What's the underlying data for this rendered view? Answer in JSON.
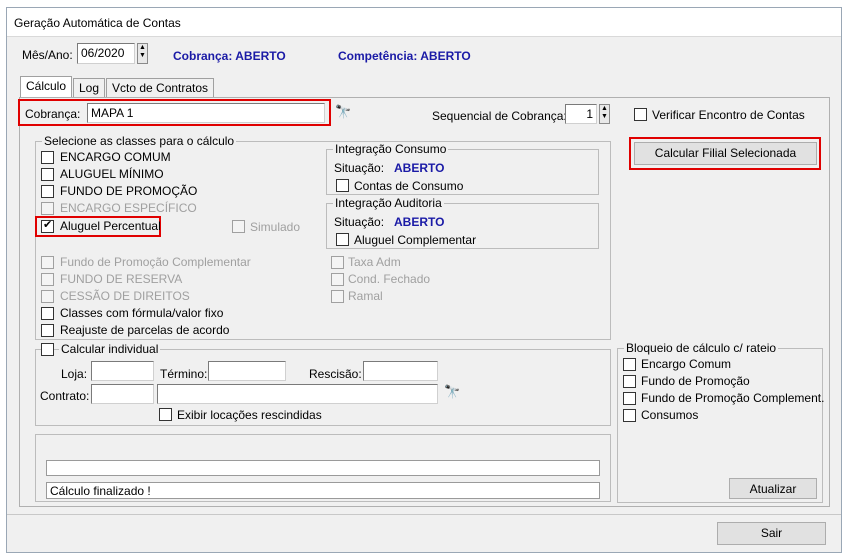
{
  "window": {
    "title": "Geração Automática de Contas"
  },
  "header": {
    "mes_ano_label": "Mês/Ano:",
    "mes_ano_value": "06/2020",
    "cobranca_status": "Cobrança: ABERTO",
    "competencia_status": "Competência: ABERTO"
  },
  "tabs": [
    "Cálculo",
    "Log",
    "Vcto de Contratos"
  ],
  "cobranca": {
    "label": "Cobrança:",
    "value": "MAPA 1",
    "sequencial_label": "Sequencial de Cobrança:",
    "sequencial_value": "1",
    "verificar_label": "Verificar Encontro de Contas"
  },
  "calc_button": "Calcular Filial Selecionada",
  "classes": {
    "title": "Selecione as classes para o cálculo",
    "items": [
      "ENCARGO COMUM",
      "ALUGUEL MÍNIMO",
      "FUNDO DE PROMOÇÃO",
      "ENCARGO ESPECÍFICO",
      "Aluguel Percentual"
    ],
    "simulado": "Simulado",
    "lower_left": [
      "Fundo de Promoção Complementar",
      "FUNDO DE RESERVA",
      "CESSÃO DE DIREITOS",
      "Classes com fórmula/valor fixo",
      "Reajuste de parcelas de acordo"
    ],
    "lower_right": [
      "Taxa Adm",
      "Cond. Fechado",
      "Ramal"
    ]
  },
  "integracao_consumo": {
    "title": "Integração Consumo",
    "situacao_label": "Situação:",
    "situacao_value": "ABERTO",
    "checkbox": "Contas de Consumo"
  },
  "integracao_auditoria": {
    "title": "Integração Auditoria",
    "situacao_label": "Situação:",
    "situacao_value": "ABERTO",
    "checkbox": "Aluguel Complementar"
  },
  "individual": {
    "title": "Calcular individual",
    "loja_label": "Loja:",
    "termino_label": "Término:",
    "rescisao_label": "Rescisão:",
    "contrato_label": "Contrato:",
    "exibir_label": "Exibir locações rescindidas"
  },
  "status": {
    "message": "Cálculo finalizado !"
  },
  "bloqueio": {
    "title": "Bloqueio de cálculo c/ rateio",
    "items": [
      "Encargo Comum",
      "Fundo de Promoção",
      "Fundo de Promoção Complement.",
      "Consumos"
    ],
    "atualizar": "Atualizar"
  },
  "footer": {
    "sair": "Sair"
  }
}
